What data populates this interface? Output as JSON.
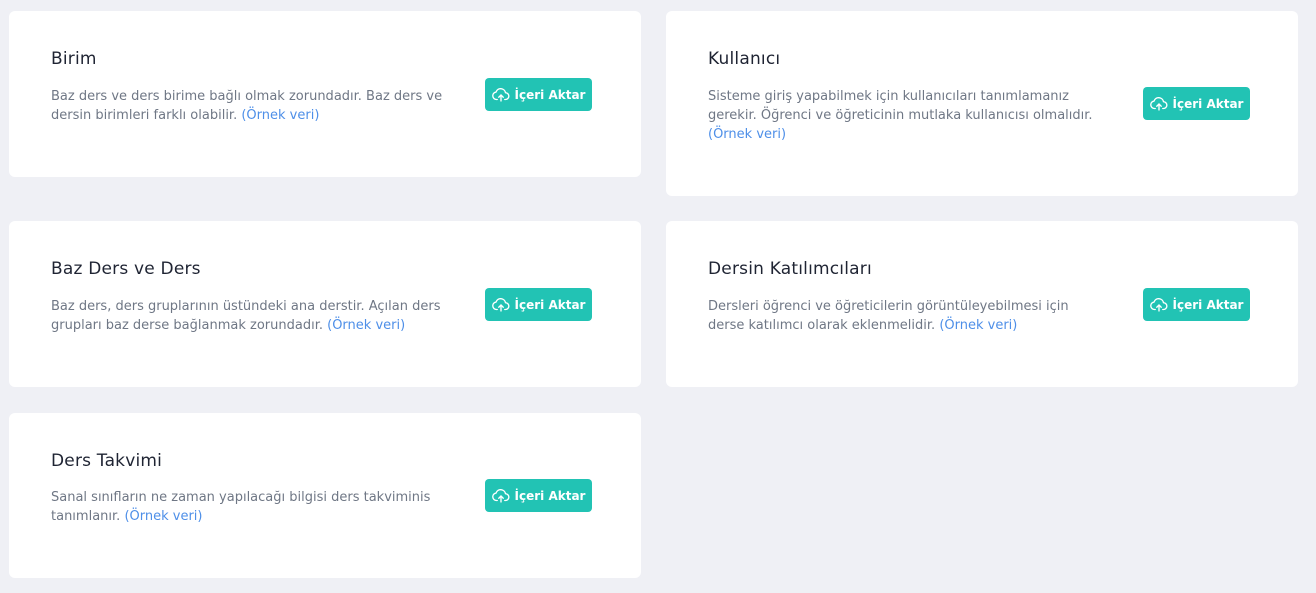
{
  "cards": [
    {
      "title": "Birim",
      "description": "Baz ders ve ders birime bağlı olmak zorundadır. Baz ders ve dersin birimleri farklı olabilir.",
      "link_label": "(Örnek veri)",
      "button_label": "İçeri Aktar"
    },
    {
      "title": "Kullanıcı",
      "description": "Sisteme giriş yapabilmek için kullanıcıları tanımlamanız gerekir. Öğrenci ve öğreticinin mutlaka kullanıcısı olmalıdır.",
      "link_label": "(Örnek veri)",
      "button_label": "İçeri Aktar"
    },
    {
      "title": "Baz Ders ve Ders",
      "description": "Baz ders, ders gruplarının üstündeki ana derstir. Açılan ders grupları baz derse bağlanmak zorundadır.",
      "link_label": "(Örnek veri)",
      "button_label": "İçeri Aktar"
    },
    {
      "title": "Dersin Katılımcıları",
      "description": "Dersleri öğrenci ve öğreticilerin görüntüleyebilmesi için derse katılımcı olarak eklenmelidir.",
      "link_label": "(Örnek veri)",
      "button_label": "İçeri Aktar"
    },
    {
      "title": "Ders Takvimi",
      "description": "Sanal sınıfların ne zaman yapılacağı bilgisi ders takviminis tanımlanır.",
      "link_label": "(Örnek veri)",
      "button_label": "İçeri Aktar"
    }
  ],
  "icons": {
    "button_icon": "cloud-upload-icon"
  },
  "colors": {
    "page_background": "#eff0f5",
    "card_background": "#ffffff",
    "button_accent": "#22c3b4",
    "link": "#4e8fe8",
    "title_text": "#1f2433",
    "description_text": "#6f7785"
  }
}
